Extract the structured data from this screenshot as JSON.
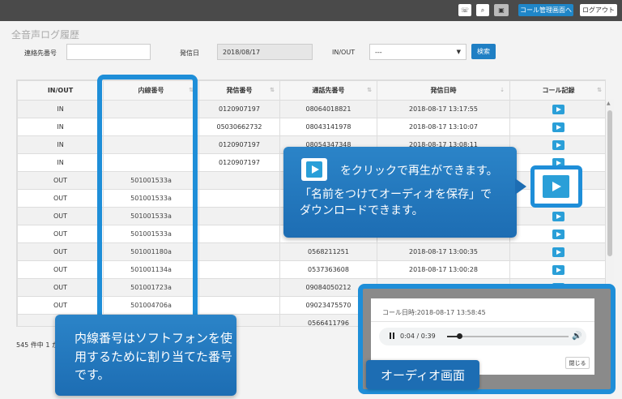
{
  "header": {
    "phone_icon": "phone-icon",
    "search_icon": "search-icon",
    "user_icon": "user-card-icon",
    "call_admin_label": "コール管理画面へ",
    "logout_label": "ログアウト"
  },
  "page": {
    "title": "全音声ログ履歴"
  },
  "filters": {
    "contact_label": "連絡先番号",
    "contact_value": "",
    "date_label": "発信日",
    "date_value": "2018/08/17",
    "direction_label": "IN/OUT",
    "direction_value": "---",
    "search_label": "検索"
  },
  "table": {
    "columns": [
      "IN/OUT",
      "内線番号",
      "発信番号",
      "通話先番号",
      "発信日時",
      "コール記録"
    ],
    "rows": [
      [
        "IN",
        "",
        "0120907197",
        "08064018821",
        "2018-08-17 13:17:55"
      ],
      [
        "IN",
        "",
        "05030662732",
        "08043141978",
        "2018-08-17 13:10:07"
      ],
      [
        "IN",
        "",
        "0120907197",
        "08054347348",
        "2018-08-17 13:08:11"
      ],
      [
        "IN",
        "",
        "0120907197",
        "",
        ""
      ],
      [
        "OUT",
        "501001533a",
        "",
        "",
        ""
      ],
      [
        "OUT",
        "501001533a",
        "",
        "",
        ""
      ],
      [
        "OUT",
        "501001533a",
        "",
        "",
        ""
      ],
      [
        "OUT",
        "501001533a",
        "",
        "",
        ""
      ],
      [
        "OUT",
        "501001180a",
        "",
        "0568211251",
        "2018-08-17 13:00:35"
      ],
      [
        "OUT",
        "501001134a",
        "",
        "0537363608",
        "2018-08-17 13:00:28"
      ],
      [
        "OUT",
        "501001723a",
        "",
        "09084050212",
        ""
      ],
      [
        "OUT",
        "501004706a",
        "",
        "09023475570",
        ""
      ],
      [
        "",
        "",
        "",
        "0566411796",
        ""
      ]
    ],
    "count_text": "545 件中 1 か"
  },
  "callouts": {
    "play_line1": "をクリックで再生ができます。",
    "play_line2": "「名前をつけてオーディオを保存」で",
    "play_line3": "ダウンロードできます。",
    "extension_text": "内線番号はソフトフォンを使用するために割り当てた番号です。"
  },
  "audio": {
    "modal_title": "コール日時:2018-08-17 13:58:45",
    "time_text": "0:04 / 0:39",
    "progress": 0.1,
    "close_label": "閉じる",
    "screen_label": "オーディオ画面"
  }
}
